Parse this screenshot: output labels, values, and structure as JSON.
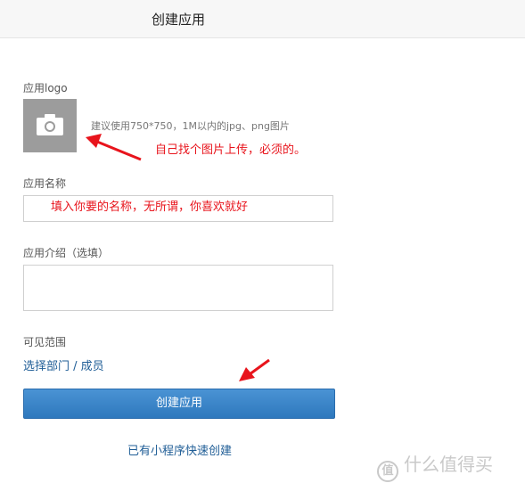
{
  "header": {
    "title": "创建应用"
  },
  "form": {
    "logo_label": "应用logo",
    "logo_hint": "建议使用750*750，1M以内的jpg、png图片",
    "name_label": "应用名称",
    "intro_label": "应用介绍（选填）",
    "scope_label": "可见范围",
    "scope_link": "选择部门 / 成员",
    "submit_label": "创建应用",
    "quick_create_link": "已有小程序快速创建"
  },
  "annotations": {
    "logo_note": "自己找个图片上传，必须的。",
    "name_note": "填入你要的名称，无所谓，你喜欢就好"
  },
  "watermark": {
    "icon_text": "值",
    "text": "什么值得买"
  },
  "colors": {
    "primary_button": "#3585c9",
    "link": "#1f5d96",
    "annotation_red": "#e8141c"
  }
}
